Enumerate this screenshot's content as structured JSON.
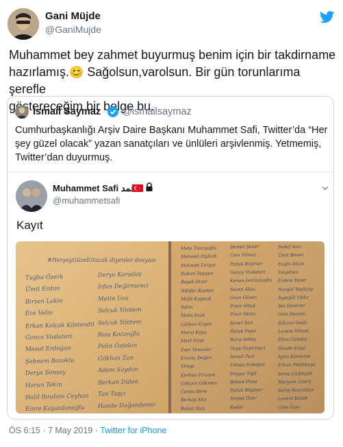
{
  "tweet": {
    "author_name": "Gani Müjde",
    "author_handle": "@GaniMujde",
    "text_line1": "Muhammet bey zahmet buyurmuş benim için bir takdirname",
    "text_line2a": "hazırlamış.",
    "emoji": "😊",
    "text_line2b": "Sağolsun,varolsun. Bir gün torunlarıma şerefle",
    "text_line3": "göstereceğim bir belge bu.",
    "timestamp": "ÖS 6:15 · 7 May 2019 ·",
    "source": "Twitter for iPhone"
  },
  "quote": {
    "author_name": "İsmail Saymaz",
    "author_handle": "@ismailsaymaz",
    "text_line1": "Cumhurbaşkanlığı Arşiv Daire Başkanı Muhammet Safi, Twitter’da “Her",
    "text_line2": "şey güzel olacak” yazan sanatçıları ve ünlüleri arşivlenmiş. Yetmemiş,",
    "text_line3": "Twitter’dan duyurmuş.",
    "inner": {
      "author_name": "Muhammet Safi محمد",
      "author_handle": "@muhammetsafi",
      "heading": "Kayıt",
      "page_left": {
        "header": "#HerşeyGüzelOlacak diyenler dosyası",
        "col1": [
          "Tuğba Özerk",
          "Ümit Erdim",
          "Birsen Lakin",
          "Ece Velio",
          "Erkan Kolçak Köstendil",
          "Gonca Vuslateri",
          "Mesut Erdoğan",
          "Şebnem Bozoklu",
          "Derya Şensoy",
          "Harun Tekin",
          "Halil Ibrahim Ceyhan",
          "Emre Kayasılonoğlu"
        ],
        "col2": [
          "Derya Karadaş",
          "İrfan Değirmenci",
          "Metin Uca",
          "Selcuk Yöntem",
          "Selcuk Yöntem",
          "Rıza Kocaoğlu",
          "Pelin Öztekin",
          "Gökhan Zan",
          "Adem Saydan",
          "Berkan Dülen",
          "Tan Taşçı",
          "Hande Doğandemir"
        ]
      },
      "page_right": {
        "col1": [
          "Meta Tuzcuoğlu",
          "Mehmet Dişlicik",
          "Mehmet Turgut",
          "Hakan Taşıyan",
          "Başak Dizer",
          "Nilüfer Kaptan",
          "Müfit Kayacık",
          "Yalım",
          "Melis Sezk",
          "Gülben Ergen",
          "Meral Kaya",
          "Mert Fırat",
          "Eser Yenenler",
          "Kıvanç Doğan",
          "Simge",
          "Korhan Firuzan",
          "Gökçen Gökmen",
          "Cansu Dere",
          "Berkay Ahu",
          "Buket Atas"
        ],
        "col2": [
          "Demet Şener",
          "Cem Yılmaz",
          "Haluk Bilginer",
          "Gonca Vuslateri",
          "Kenan İmirzalıoğlu",
          "Sezen Aksu",
          "Ozan Güven",
          "Pınar Altuğ",
          "Pınar Deniz",
          "Şener Şen",
          "Haluk Piyes",
          "Barış Arduç",
          "Özge Özpirinçci",
          "İsmail Paul",
          "Yılmaz Erdoğan",
          "Feyyaz Yiğit",
          "Bülent Polat",
          "Haluk Bilginer",
          "Ahmet Özer",
          "Kodal"
        ],
        "col3": [
          "Sedef Avcı",
          "Ümit Besen",
          "Engin Altan",
          "Tolgahan",
          "Erdem Yener",
          "Nurgül Yeşilçay",
          "Ayşegül Yıldız",
          "Ata Demirer",
          "Cem Davran",
          "Şükran Ovalı",
          "Levent Yüksel",
          "Ebru Gündeş",
          "Hande Erçel",
          "Aylin Kontente",
          "Erkan Petekkaya",
          "Sema Çağlayan",
          "Meryem Uzerli",
          "Selim Bayraktar",
          "Levent Kazak",
          "Cem Özer"
        ]
      }
    }
  }
}
